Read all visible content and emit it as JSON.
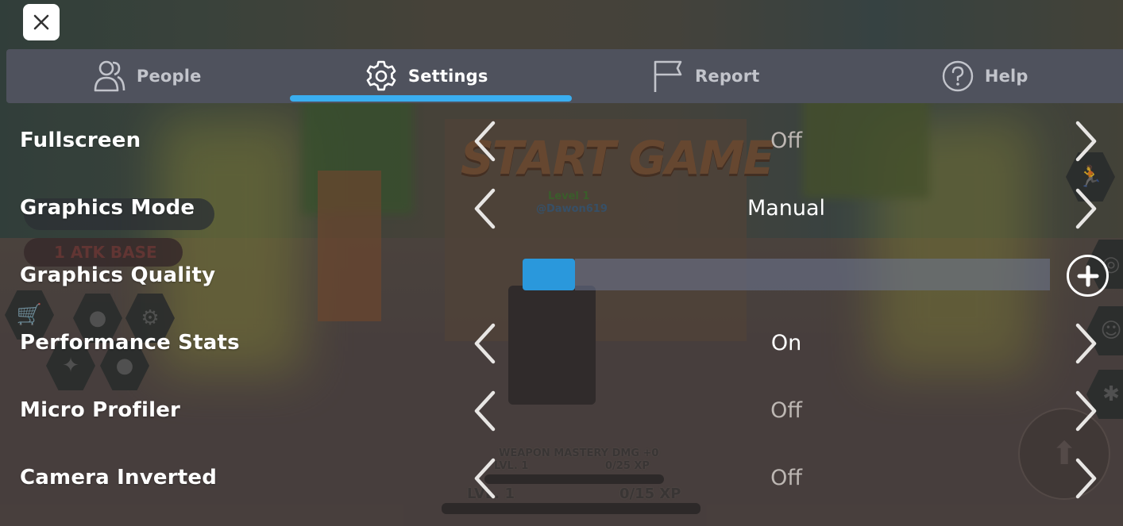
{
  "colors": {
    "tab_bar_bg": "#4f525d",
    "accent": "#3aaef0",
    "quality_fill": "#2a98dc",
    "text_active": "#ffffff",
    "text_inactive": "#c2c4cb",
    "value_dim": "#bdb7b3"
  },
  "close_button": {
    "icon": "close-icon"
  },
  "tabs": [
    {
      "label": "People",
      "icon": "people-icon",
      "active": false
    },
    {
      "label": "Settings",
      "icon": "gear-icon",
      "active": true
    },
    {
      "label": "Report",
      "icon": "flag-icon",
      "active": false
    },
    {
      "label": "Help",
      "icon": "help-icon",
      "active": false
    }
  ],
  "settings": [
    {
      "label": "Fullscreen",
      "type": "selector",
      "value": "Off",
      "enabled": false
    },
    {
      "label": "Graphics Mode",
      "type": "selector",
      "value": "Manual",
      "enabled": true
    },
    {
      "label": "Graphics Quality",
      "type": "slider",
      "level": 1,
      "max_level": 10
    },
    {
      "label": "Performance Stats",
      "type": "selector",
      "value": "On",
      "enabled": true
    },
    {
      "label": "Micro Profiler",
      "type": "selector",
      "value": "Off",
      "enabled": false
    },
    {
      "label": "Camera Inverted",
      "type": "selector",
      "value": "Off",
      "enabled": false
    }
  ],
  "background_game": {
    "logo": "START GAME",
    "level": "Level 1",
    "username": "@Dawon619",
    "atk_badge": "1 ATK BASE",
    "weapon_mastery": "WEAPON MASTERY DMG +0",
    "weapon_level": "LVL. 1",
    "weapon_xp": "0/25 XP",
    "player_level": "LVL. 1",
    "player_xp": "0/15 XP"
  }
}
